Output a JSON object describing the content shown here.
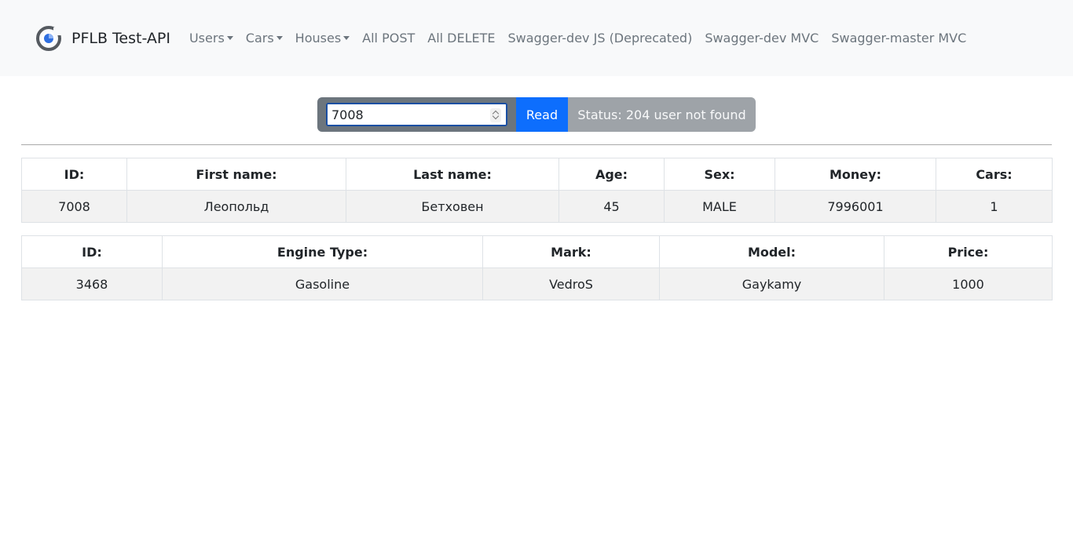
{
  "navbar": {
    "brand": "PFLB Test-API",
    "links": [
      {
        "label": "Users",
        "dropdown": true
      },
      {
        "label": "Cars",
        "dropdown": true
      },
      {
        "label": "Houses",
        "dropdown": true
      },
      {
        "label": "All POST",
        "dropdown": false
      },
      {
        "label": "All DELETE",
        "dropdown": false
      },
      {
        "label": "Swagger-dev JS (Deprecated)",
        "dropdown": false
      },
      {
        "label": "Swagger-dev MVC",
        "dropdown": false
      },
      {
        "label": "Swagger-master MVC",
        "dropdown": false
      }
    ]
  },
  "controls": {
    "user_id_value": "7008",
    "read_label": "Read",
    "status_text": "Status: 204 user not found"
  },
  "user_table": {
    "headers": [
      "ID:",
      "First name:",
      "Last name:",
      "Age:",
      "Sex:",
      "Money:",
      "Cars:"
    ],
    "rows": [
      [
        "7008",
        "Леопольд",
        "Бетховен",
        "45",
        "MALE",
        "7996001",
        "1"
      ]
    ]
  },
  "cars_table": {
    "headers": [
      "ID:",
      "Engine Type:",
      "Mark:",
      "Model:",
      "Price:"
    ],
    "rows": [
      [
        "3468",
        "Gasoline",
        "VedroS",
        "Gaykamy",
        "1000"
      ]
    ]
  },
  "colors": {
    "accent": "#0d6efd",
    "status_bg": "#9ea3a8",
    "input_group_bg": "#6c757d"
  }
}
